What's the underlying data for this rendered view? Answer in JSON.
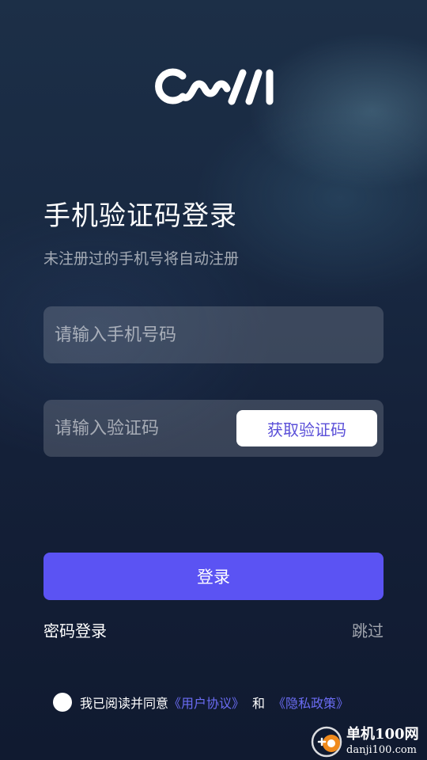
{
  "brand": {
    "logo_text": "OMAI",
    "logo_icon": "omai-logo"
  },
  "header": {
    "title": "手机验证码登录",
    "subtitle": "未注册过的手机号将自动注册"
  },
  "form": {
    "phone_placeholder": "请输入手机号码",
    "phone_value": "",
    "code_placeholder": "请输入验证码",
    "code_value": "",
    "get_code_label": "获取验证码",
    "login_label": "登录"
  },
  "links": {
    "password_login": "密码登录",
    "skip": "跳过"
  },
  "agreement": {
    "checked": false,
    "prefix": "我已阅读并同意",
    "user_agreement": "《用户协议》",
    "and": "和",
    "privacy_policy": "《隐私政策》"
  },
  "watermark": {
    "name": "单机100网",
    "domain": "danji100.com",
    "icon": "danji100-logo"
  },
  "colors": {
    "accent": "#5b53f3",
    "link": "#6b6cf4",
    "get_code_text": "#5a4fd8",
    "background": "#162439"
  }
}
